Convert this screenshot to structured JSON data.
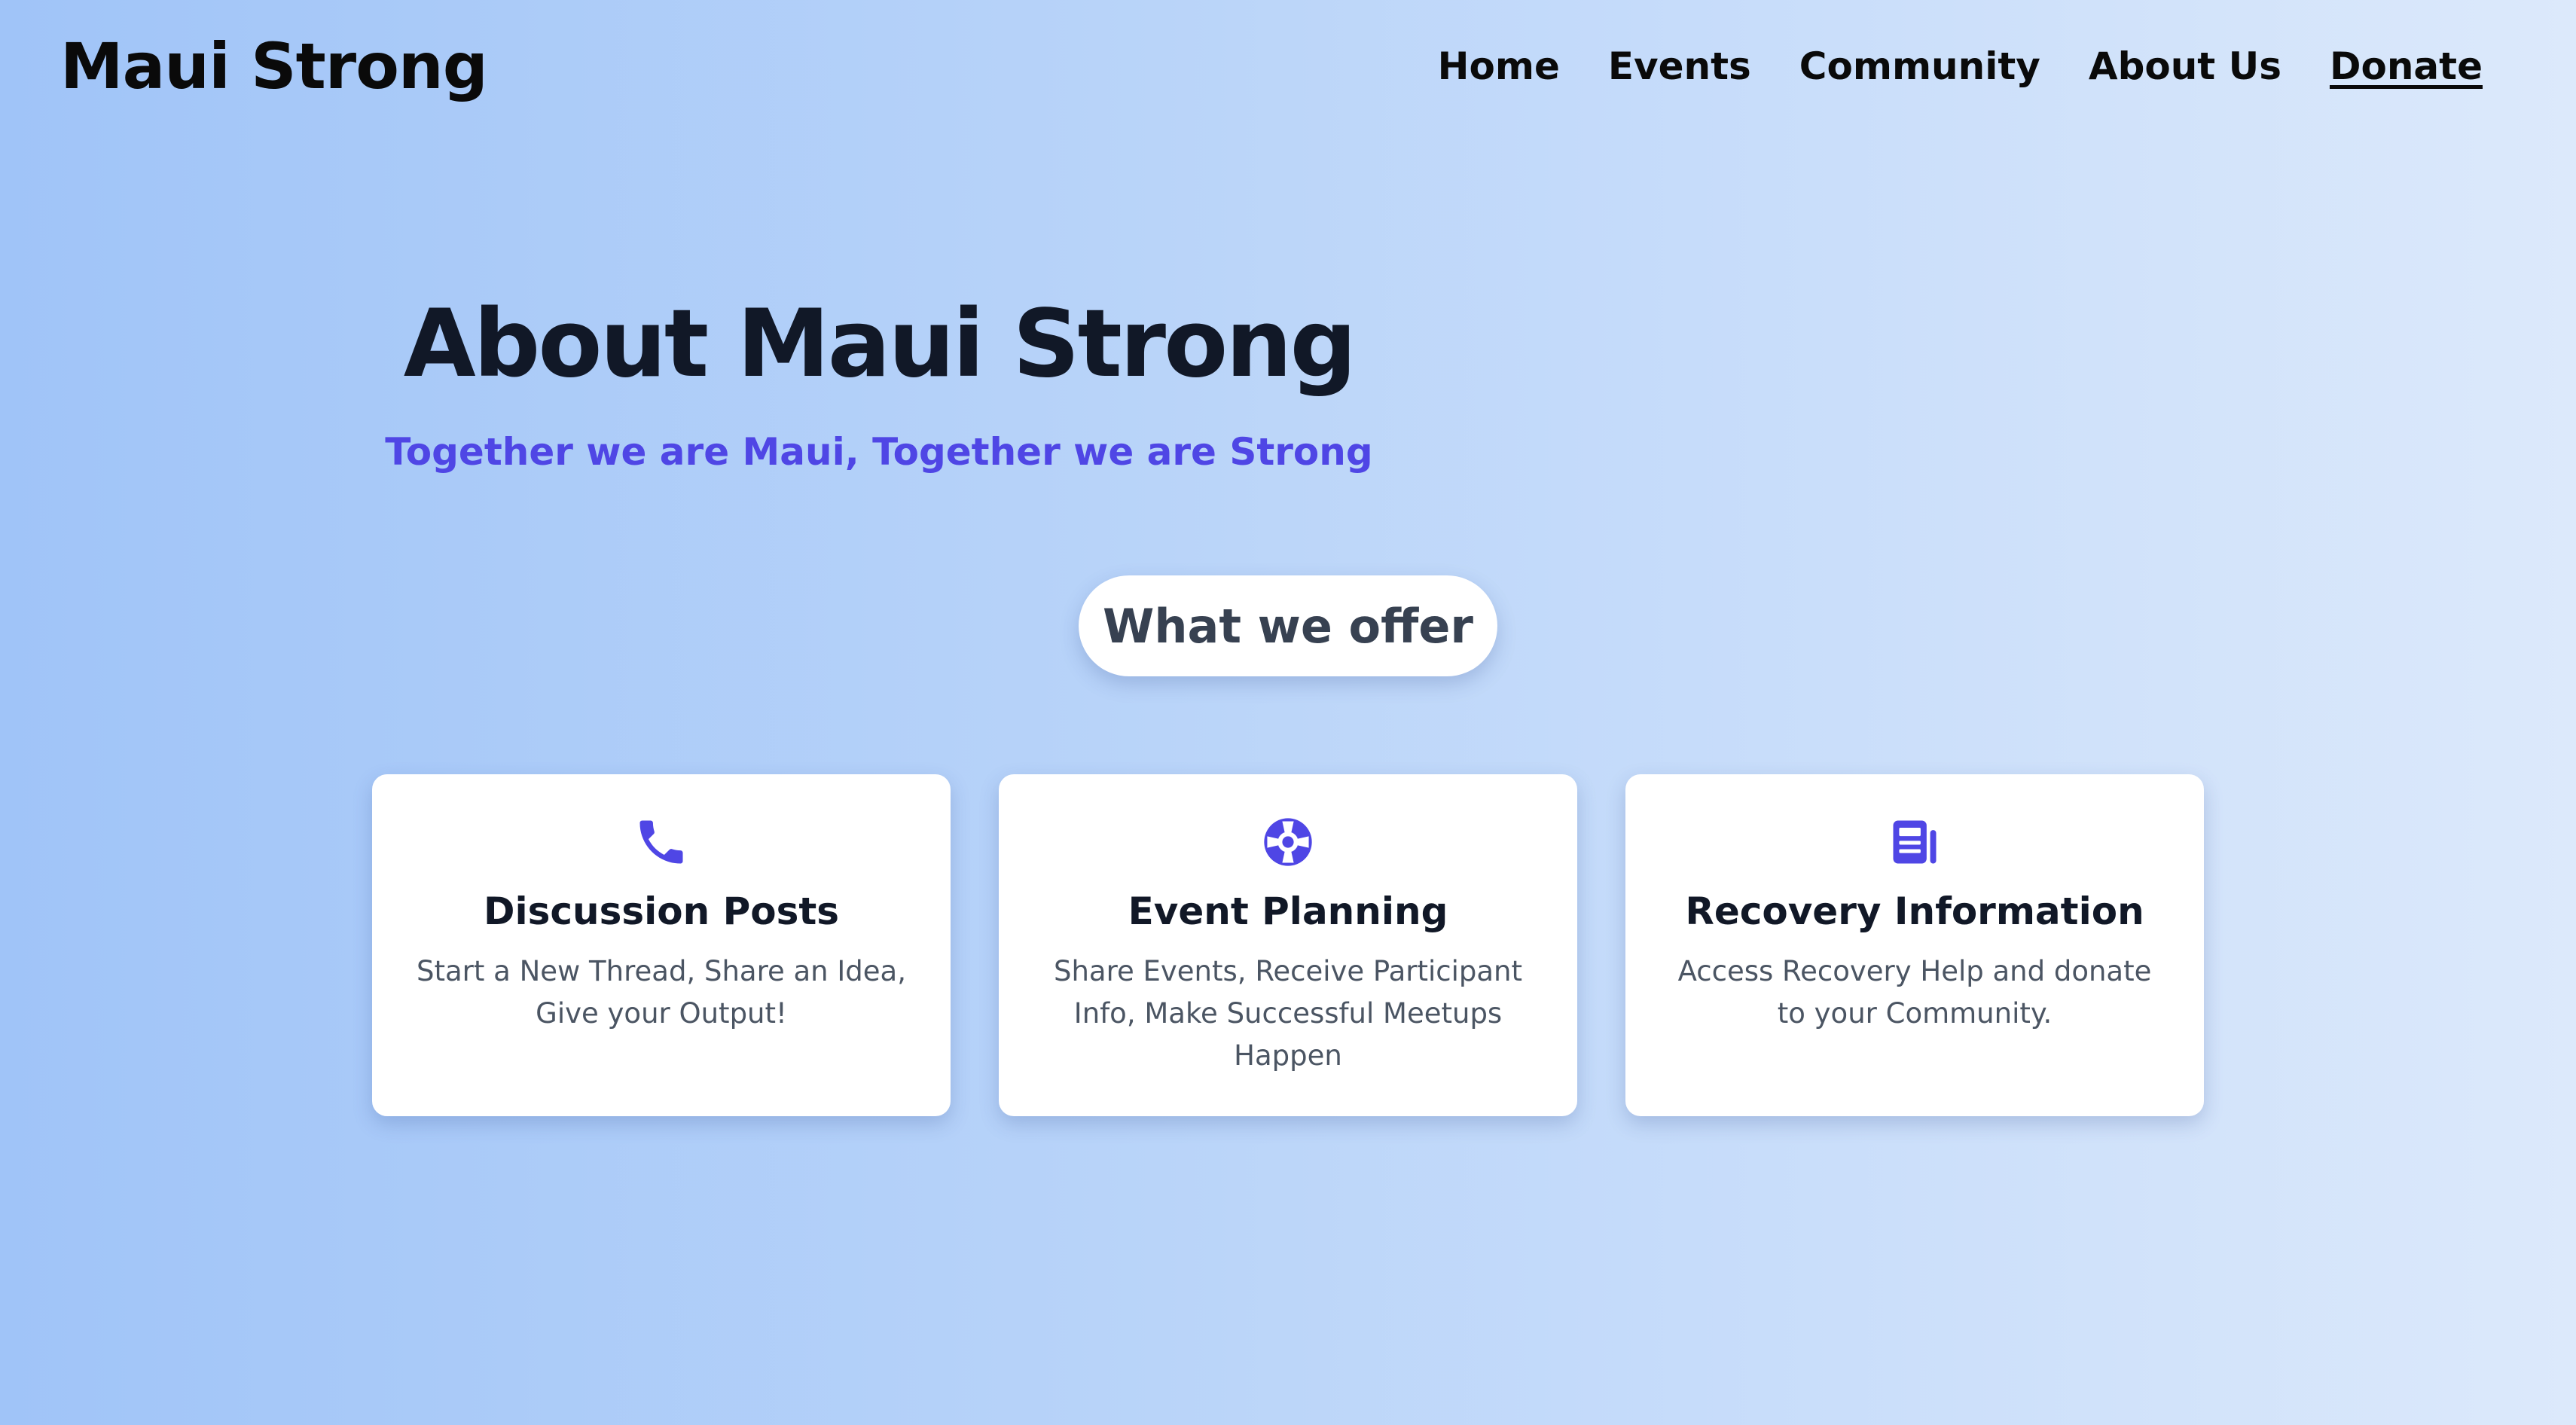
{
  "header": {
    "brand": "Maui Strong",
    "nav": [
      {
        "label": "Home"
      },
      {
        "label": "Events"
      },
      {
        "label": "Community"
      },
      {
        "label": "About Us"
      },
      {
        "label": "Donate"
      }
    ]
  },
  "hero": {
    "title": "About Maui Strong",
    "subtitle": "Together we are Maui, Together we are Strong"
  },
  "offer": {
    "label": "What we offer"
  },
  "cards": [
    {
      "icon": "phone-icon",
      "title": "Discussion Posts",
      "description": "Start a New Thread, Share an Idea, Give your Output!"
    },
    {
      "icon": "life-ring-icon",
      "title": "Event Planning",
      "description": "Share Events, Receive Participant Info, Make Successful Meetups Happen"
    },
    {
      "icon": "newspaper-icon",
      "title": "Recovery Information",
      "description": "Access Recovery Help and donate to your Community."
    }
  ],
  "colors": {
    "accent": "#4f46e5",
    "heading": "#111827",
    "body_text": "#4b5563",
    "background_start": "#a0c4f8",
    "background_end": "#dce9fb"
  }
}
